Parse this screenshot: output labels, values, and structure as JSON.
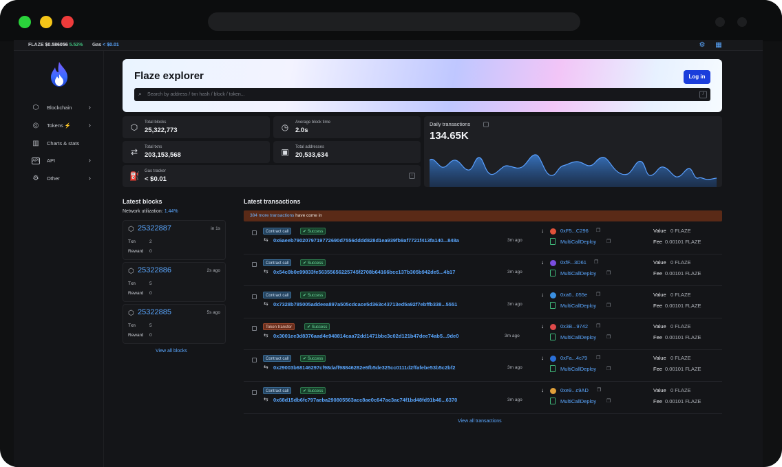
{
  "topbar": {
    "token": "FLAZE",
    "price": "$0.586056",
    "change": "5.52%",
    "gas_label": "Gas",
    "gas_value": "< $0.01"
  },
  "sidebar": {
    "items": [
      {
        "label": "Blockchain",
        "icon": "cube-icon",
        "chevron": true
      },
      {
        "label": "Tokens",
        "icon": "tokens-icon",
        "chevron": true,
        "badge": "⚡"
      },
      {
        "label": "Charts & stats",
        "icon": "chart-icon",
        "chevron": false
      },
      {
        "label": "API",
        "icon": "api-icon",
        "chevron": true
      },
      {
        "label": "Other",
        "icon": "gear-icon",
        "chevron": true
      }
    ]
  },
  "hero": {
    "title": "Flaze explorer",
    "login_label": "Log in",
    "search_placeholder": "Search by address / txn hash / block / token...",
    "search_key": "/"
  },
  "stats": {
    "total_blocks": {
      "label": "Total blocks",
      "value": "25,322,773"
    },
    "avg_block_time": {
      "label": "Average block time",
      "value": "2.0s"
    },
    "total_txns": {
      "label": "Total txns",
      "value": "203,153,568"
    },
    "total_addresses": {
      "label": "Total addresses",
      "value": "20,533,634"
    },
    "gas_tracker": {
      "label": "Gas tracker",
      "value": "< $0.01"
    }
  },
  "daily": {
    "label": "Daily transactions",
    "value": "134.65K",
    "color": "#3b7fd4"
  },
  "blocks": {
    "title": "Latest blocks",
    "net_label": "Network utilization:",
    "net_value": "1.44%",
    "txn_label": "Txn",
    "reward_label": "Reward",
    "items": [
      {
        "number": "25322887",
        "age": "in 1s",
        "txn": "2",
        "reward": "0"
      },
      {
        "number": "25322886",
        "age": "2s ago",
        "txn": "5",
        "reward": "0"
      },
      {
        "number": "25322885",
        "age": "5s ago",
        "txn": "5",
        "reward": "0"
      }
    ],
    "view_all": "View all blocks"
  },
  "txns": {
    "title": "Latest transactions",
    "banner_count": "384 more transactions",
    "banner_rest": " have come in",
    "value_label": "Value",
    "fee_label": "Fee",
    "items": [
      {
        "type": "Contract call",
        "status": "Success",
        "hash": "0x6aeeb7902079719772690d7556dddd828d1ea939fb9af7721f413fa140...848a",
        "age": "3m ago",
        "from": "0xF5...C296",
        "to": "MultiCallDeploy",
        "value": "0 FLAZE",
        "fee": "0.00101 FLAZE",
        "avatar": "#e0523a"
      },
      {
        "type": "Contract call",
        "status": "Success",
        "hash": "0x54c0b0e99833fe56355656225745f2708b64166bcc137b305b942de5...4b17",
        "age": "3m ago",
        "from": "0xfF...3D61",
        "to": "MultiCallDeploy",
        "value": "0 FLAZE",
        "fee": "0.00101 FLAZE",
        "avatar": "#7a4de0"
      },
      {
        "type": "Contract call",
        "status": "Success",
        "hash": "0x7328b785005addeea897a505cdcace5d363c43713ed5a92f7ebffb338...5551",
        "age": "3m ago",
        "from": "0xa6...055e",
        "to": "MultiCallDeploy",
        "value": "0 FLAZE",
        "fee": "0.00101 FLAZE",
        "avatar": "#3a8fe0"
      },
      {
        "type": "Token transfer",
        "status": "Success",
        "hash": "0x3001ee3d8376aad4e948814caa72dd1471bbc3c02d121b47dee74ab5...9de0",
        "age": "3m ago",
        "from": "0x3B...9742",
        "to": "MultiCallDeploy",
        "value": "0 FLAZE",
        "fee": "0.00101 FLAZE",
        "avatar": "#e04a4a"
      },
      {
        "type": "Contract call",
        "status": "Success",
        "hash": "0x29003b68146297cf98daff98846282e6fb5de325cc0111d2ffafebe53b5c2bf2",
        "age": "3m ago",
        "from": "0xFa...4c79",
        "to": "MultiCallDeploy",
        "value": "0 FLAZE",
        "fee": "0.00101 FLAZE",
        "avatar": "#2a6fd6"
      },
      {
        "type": "Contract call",
        "status": "Success",
        "hash": "0x68d15db6fc797aeba290805563acc8ae0c647ac3ac74f1bd48fd91b46...6370",
        "age": "3m ago",
        "from": "0xe9...c9AD",
        "to": "MultiCallDeploy",
        "value": "0 FLAZE",
        "fee": "0.00101 FLAZE",
        "avatar": "#e0a03a"
      }
    ],
    "view_all": "View all transactions"
  }
}
